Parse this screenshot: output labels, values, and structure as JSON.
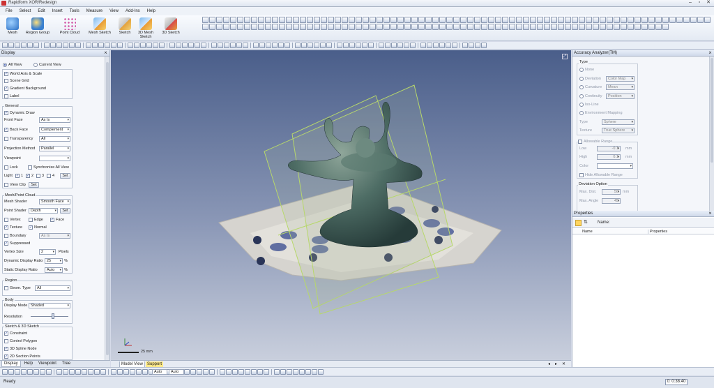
{
  "app": {
    "title": "Rapidform XOR/Redesign"
  },
  "menu": [
    "File",
    "Select",
    "Edit",
    "Insert",
    "Tools",
    "Measure",
    "View",
    "Add-Ins",
    "Help"
  ],
  "ribbon": {
    "buttons": [
      {
        "label": "Mesh",
        "icon": "mesh-icon"
      },
      {
        "label": "Region Group",
        "icon": "region-group-icon"
      },
      {
        "label": "Point Cloud",
        "icon": "point-cloud-icon"
      },
      {
        "label": "Mesh Sketch",
        "icon": "mesh-sketch-icon"
      },
      {
        "label": "Sketch",
        "icon": "sketch-icon"
      },
      {
        "label": "3D Mesh Sketch",
        "icon": "3d-mesh-sketch-icon"
      },
      {
        "label": "3D Sketch",
        "icon": "3d-sketch-icon"
      }
    ]
  },
  "left_panel": {
    "title": "Display",
    "view_options": {
      "all_view": "All View",
      "current_view": "Current View"
    },
    "display_items": [
      {
        "label": "World Axis & Scale",
        "checked": true
      },
      {
        "label": "Scene Grid",
        "checked": false
      },
      {
        "label": "Gradient Background",
        "checked": true
      },
      {
        "label": "Label",
        "checked": false
      }
    ],
    "general": {
      "title": "General",
      "dynamic_draw": "Dynamic Draw",
      "front_face_label": "Front Face",
      "front_face_value": "As Is",
      "back_face_label": "Back Face",
      "back_face_value": "Complement",
      "transparency_label": "Transparency",
      "transparency_value": "All",
      "projection_label": "Projection Method",
      "projection_value": "Parallel",
      "viewpoint_label": "Viewpoint",
      "lock_label": "Lock",
      "sync_label": "Synchronize All View",
      "light_label": "Light",
      "lights": [
        "1",
        "2",
        "3",
        "4"
      ],
      "set_label": "Set",
      "view_clip_label": "View Clip"
    },
    "mesh": {
      "title": "Mesh/Point Cloud",
      "mesh_shader_label": "Mesh Shader",
      "mesh_shader_value": "Smooth Face",
      "point_shader_label": "Point Shader",
      "point_shader_value": "Depth",
      "set_label": "Set",
      "vertex": "Vertex",
      "edge": "Edge",
      "face": "Face",
      "texture": "Texture",
      "normal": "Normal",
      "boundary": "Boundary",
      "boundary_value": "As Is",
      "suppressed": "Suppressed",
      "vertex_size_label": "Vertex Size",
      "vertex_size_value": "2",
      "pixels": "Pixels",
      "dyn_ratio_label": "Dynamic Display Ratio",
      "dyn_ratio_value": "25",
      "static_ratio_label": "Static Display Ratio",
      "static_ratio_value": "Auto",
      "percent": "%"
    },
    "region": {
      "title": "Region",
      "geom_type_label": "Geom. Type",
      "geom_type_value": "All"
    },
    "body": {
      "title": "Body",
      "display_mode_label": "Display Mode",
      "display_mode_value": "Shaded",
      "resolution_label": "Resolution"
    },
    "sketch": {
      "title": "Sketch & 3D Sketch",
      "items": [
        "Constraint",
        "Control Polygon",
        "3D Spline Node",
        "2D Section Points"
      ]
    },
    "tabs": [
      "Display",
      "Help",
      "Viewpoint",
      "Tree"
    ]
  },
  "viewport": {
    "scale_label": "25 mm",
    "tabs": [
      "Model View",
      "Support"
    ]
  },
  "accuracy": {
    "title": "Accuracy Analyzer(TM)",
    "type_label": "Type",
    "options": [
      "None",
      "Deviation",
      "Curvature",
      "Continuity",
      "Iso-Line",
      "Environment Mapping"
    ],
    "deviation_value": "Color Map",
    "curvature_value": "Mean",
    "continuity_value": "Position",
    "type_sub": "Type",
    "type_sub_value": "Sphere",
    "texture_label": "Texture",
    "texture_value": "True Sphere",
    "allowable_label": "Allowable Range",
    "low_label": "Low",
    "low_value": "-0.1",
    "high_label": "High",
    "high_value": "0.1",
    "mm": "mm",
    "color_label": "Color",
    "hide_label": "Hide Allowable Range",
    "devopt_label": "Deviation Option",
    "max_dist_label": "Max. Dist.",
    "max_dist_value": "50",
    "max_angle_label": "Max. Angle",
    "max_angle_value": "45"
  },
  "properties": {
    "title": "Properties",
    "name_label": "Name:",
    "col_name": "Name",
    "col_props": "Properties"
  },
  "status": {
    "ready": "Ready",
    "time": "0: 0:38.40",
    "auto1": "Auto",
    "auto2": "Auto"
  }
}
